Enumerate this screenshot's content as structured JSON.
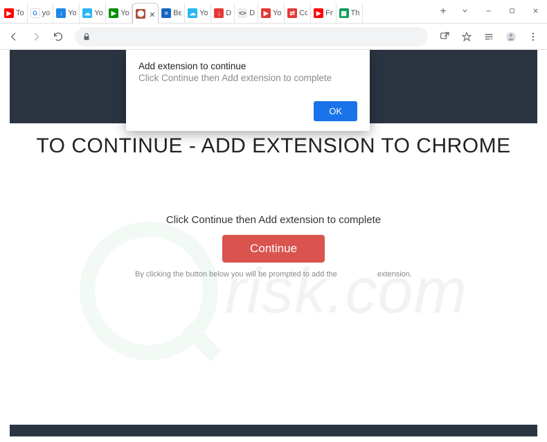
{
  "window": {
    "tabs": [
      {
        "label": "To",
        "icon": "youtube"
      },
      {
        "label": "yo",
        "icon": "google"
      },
      {
        "label": "Yo",
        "icon": "download-blue"
      },
      {
        "label": "Yo",
        "icon": "download-cloud"
      },
      {
        "label": "Yo",
        "icon": "play-green"
      },
      {
        "label": "",
        "icon": "page",
        "active": true
      },
      {
        "label": "Be",
        "icon": "bars-blue"
      },
      {
        "label": "Yo",
        "icon": "download-cloud"
      },
      {
        "label": "D ",
        "icon": "download-red"
      },
      {
        "label": "D ",
        "icon": "code"
      },
      {
        "label": "Yo",
        "icon": "play-red"
      },
      {
        "label": "Co",
        "icon": "convert-red"
      },
      {
        "label": "Fr",
        "icon": "youtube"
      },
      {
        "label": "Th",
        "icon": "sheets"
      }
    ],
    "new_tab": "+",
    "controls": {
      "minimize": "–",
      "maximize": "▢",
      "close": "✕",
      "dropdown": "⌄"
    }
  },
  "toolbar": {
    "url": ""
  },
  "dialog": {
    "title": "Add extension to continue",
    "message": "Click Continue then Add extension to complete",
    "ok": "OK"
  },
  "page": {
    "headline": "TO CONTINUE - ADD EXTENSION TO CHROME",
    "subline": "Click Continue then Add extension to complete",
    "continue": "Continue",
    "disclaimer_before": "By clicking the button below you will be prompted to add the",
    "disclaimer_after": "extension."
  },
  "watermark": {
    "text": "risk.com"
  }
}
